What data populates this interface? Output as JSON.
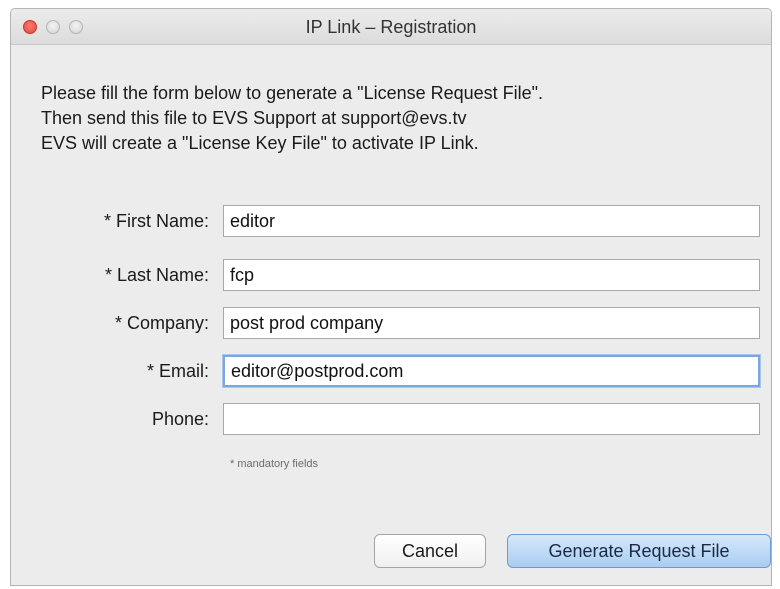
{
  "window": {
    "title": "IP Link – Registration"
  },
  "intro": {
    "line1": "Please fill the form below to generate a \"License Request File\".",
    "line2": "Then send this file to EVS Support at support@evs.tv",
    "line3": "EVS will create a \"License Key File\" to activate IP Link."
  },
  "form": {
    "first_name": {
      "label": "* First Name:",
      "value": "editor"
    },
    "last_name": {
      "label": "* Last Name:",
      "value": "fcp"
    },
    "company": {
      "label": "* Company:",
      "value": "post prod company"
    },
    "email": {
      "label": "* Email:",
      "value": "editor@postprod.com"
    },
    "phone": {
      "label": "Phone:",
      "value": ""
    },
    "hint": "* mandatory fields"
  },
  "buttons": {
    "cancel": "Cancel",
    "generate": "Generate Request File"
  },
  "colors": {
    "window_bg": "#ececec",
    "focus_ring": "#7aa7e0",
    "primary_button": "#a9cdf3"
  }
}
